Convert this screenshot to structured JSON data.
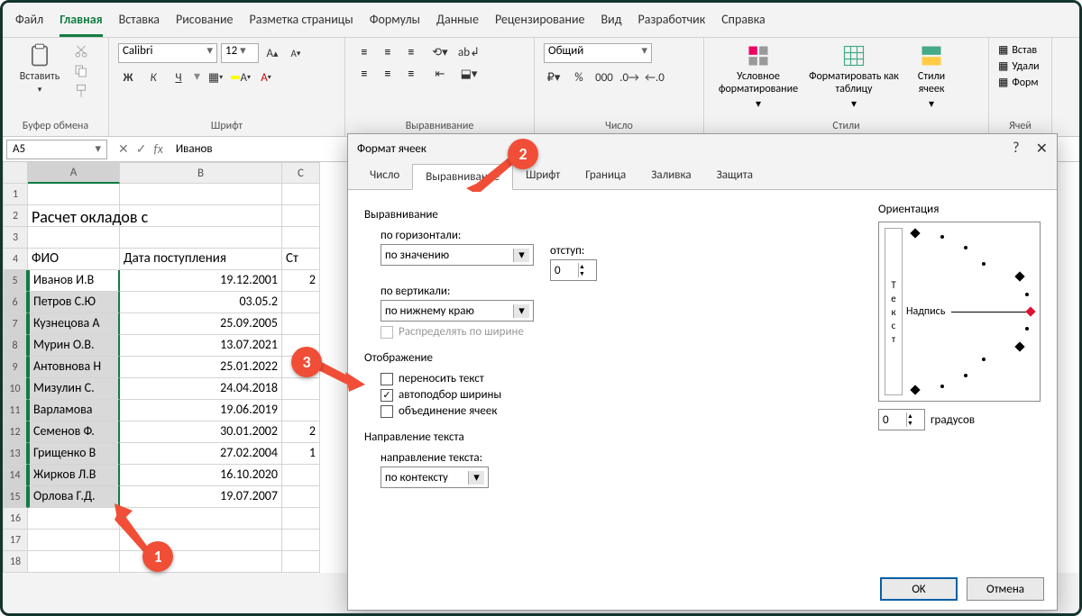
{
  "menu": {
    "file": "Файл",
    "home": "Главная",
    "insert": "Вставка",
    "draw": "Рисование",
    "layout": "Разметка страницы",
    "formulas": "Формулы",
    "data": "Данные",
    "review": "Рецензирование",
    "view": "Вид",
    "developer": "Разработчик",
    "help": "Справка"
  },
  "ribbon": {
    "clipboard": {
      "paste": "Вставить",
      "label": "Буфер обмена"
    },
    "font": {
      "name": "Calibri",
      "size": "12",
      "label": "Шрифт",
      "bold": "Ж",
      "italic": "К",
      "underline": "Ч"
    },
    "alignment": {
      "label": "Выравнивание"
    },
    "number": {
      "format": "Общий",
      "label": "Число"
    },
    "styles": {
      "cond": "Условное форматирование",
      "table": "Форматировать как таблицу",
      "cell": "Стили ячеек",
      "label": "Стили"
    },
    "cells": {
      "insert": "Встав",
      "delete": "Удали",
      "format": "Форм",
      "label": "Ячей"
    }
  },
  "namebox": "A5",
  "fx_value": "Иванов",
  "columns": [
    "A",
    "B",
    "C"
  ],
  "title_row": "Расчет окладов с",
  "headers": {
    "a": "ФИО",
    "b": "Дата поступления",
    "c": "Ст"
  },
  "rows": [
    {
      "n": "5",
      "a": "Иванов И.В",
      "b": "19.12.2001",
      "c": "2"
    },
    {
      "n": "6",
      "a": "Петров С.Ю",
      "b": "03.05.2",
      "c": ""
    },
    {
      "n": "7",
      "a": "Кузнецова А",
      "b": "25.09.2005",
      "c": ""
    },
    {
      "n": "8",
      "a": "Мурин О.В.",
      "b": "13.07.2021",
      "c": ""
    },
    {
      "n": "9",
      "a": "Антовнова Н",
      "b": "25.01.2022",
      "c": ""
    },
    {
      "n": "10",
      "a": "Мизулин С.",
      "b": "24.04.2018",
      "c": ""
    },
    {
      "n": "11",
      "a": "Варламова",
      "b": "19.06.2019",
      "c": ""
    },
    {
      "n": "12",
      "a": "Семенов Ф.",
      "b": "30.01.2002",
      "c": "2"
    },
    {
      "n": "13",
      "a": "Грищенко В",
      "b": "27.02.2004",
      "c": "1"
    },
    {
      "n": "14",
      "a": "Жирков Л.В",
      "b": "16.10.2020",
      "c": ""
    },
    {
      "n": "15",
      "a": "Орлова Г.Д.",
      "b": "19.07.2007",
      "c": ""
    }
  ],
  "dialog": {
    "title": "Формат ячеек",
    "tabs": {
      "number": "Число",
      "align": "Выравнивание",
      "font": "Шрифт",
      "border": "Граница",
      "fill": "Заливка",
      "protect": "Защита"
    },
    "section_align": "Выравнивание",
    "h_label": "по горизонтали:",
    "h_value": "по значению",
    "indent_label": "отступ:",
    "indent_value": "0",
    "v_label": "по вертикали:",
    "v_value": "по нижнему краю",
    "justify": "Распределять по ширине",
    "section_display": "Отображение",
    "wrap": "переносить текст",
    "shrink": "автоподбор ширины",
    "merge": "объединение ячеек",
    "section_dir": "Направление текста",
    "dir_label": "направление текста:",
    "dir_value": "по контексту",
    "orient_label": "Ориентация",
    "orient_text": "Текст",
    "orient_caption": "Надпись",
    "degrees_value": "0",
    "degrees_label": "градусов",
    "ok": "OK",
    "cancel": "Отмена"
  },
  "markers": {
    "m1": "1",
    "m2": "2",
    "m3": "3"
  }
}
